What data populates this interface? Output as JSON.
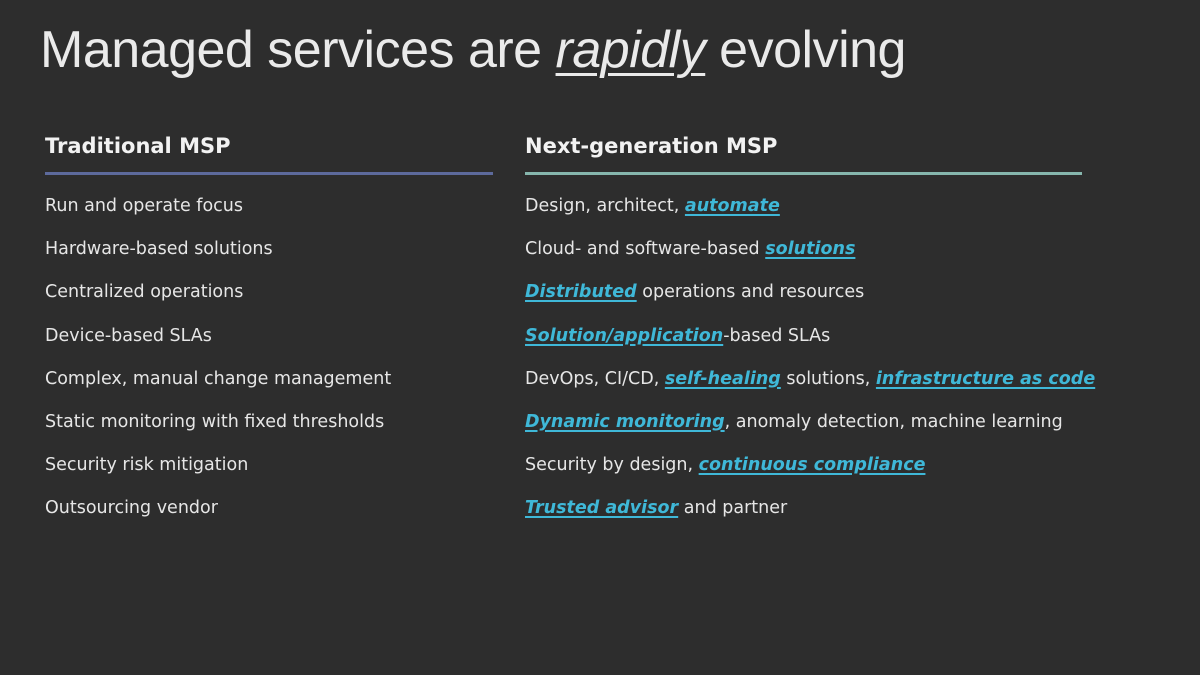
{
  "slide": {
    "title_pre": "Managed services are ",
    "title_emph": "rapidly",
    "title_post": " evolving"
  },
  "colors": {
    "background": "#2d2d2d",
    "highlight": "#3fb8d8",
    "left_rule": "#5d6a9c",
    "right_rule": "#86b6ad"
  },
  "traditional": {
    "heading": "Traditional MSP",
    "items": [
      "Run and operate focus",
      "Hardware-based solutions",
      "Centralized operations",
      "Device-based SLAs",
      "Complex, manual change management",
      "Static monitoring with fixed thresholds",
      "Security risk mitigation",
      "Outsourcing vendor"
    ]
  },
  "nextgen": {
    "heading": "Next-generation MSP",
    "items": [
      [
        {
          "t": "Design, architect, "
        },
        {
          "t": "automate",
          "hl": true
        }
      ],
      [
        {
          "t": "Cloud- and software-based "
        },
        {
          "t": "solutions",
          "hl": true
        }
      ],
      [
        {
          "t": "Distributed",
          "hl": true
        },
        {
          "t": " operations and resources"
        }
      ],
      [
        {
          "t": "Solution/application",
          "hl": true
        },
        {
          "t": "-based SLAs"
        }
      ],
      [
        {
          "t": "DevOps, CI/CD, "
        },
        {
          "t": "self-healing",
          "hl": true
        },
        {
          "t": " solutions, "
        },
        {
          "t": "infrastructure as code",
          "hl": true
        }
      ],
      [
        {
          "t": "Dynamic monitoring",
          "hl": true
        },
        {
          "t": ", anomaly detection, machine learning"
        }
      ],
      [
        {
          "t": "Security by design, "
        },
        {
          "t": "continuous compliance",
          "hl": true
        }
      ],
      [
        {
          "t": "Trusted advisor",
          "hl": true
        },
        {
          "t": " and partner"
        }
      ]
    ]
  }
}
